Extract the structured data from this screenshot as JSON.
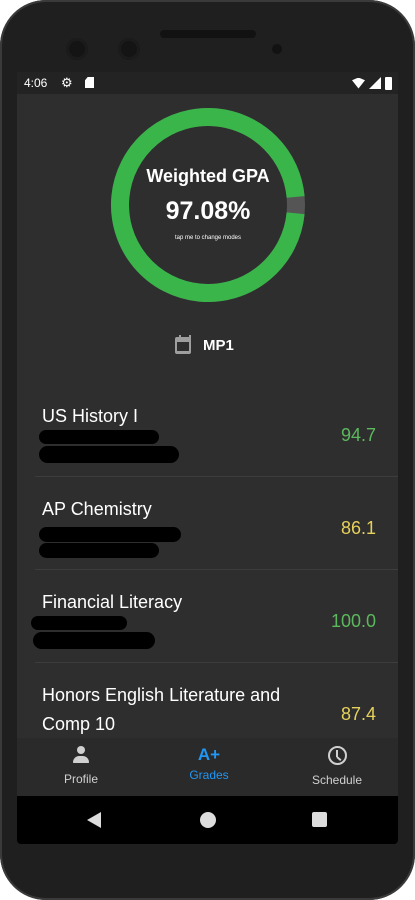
{
  "status_bar": {
    "time": "4:06",
    "icons": [
      "gear-icon",
      "sd-card-icon",
      "wifi-icon",
      "signal-icon",
      "battery-icon"
    ]
  },
  "gpa": {
    "title": "Weighted GPA",
    "value": "97.08%",
    "hint": "tap me to change modes",
    "ring_fraction": 0.97,
    "ring_color": "#3ab54a",
    "track_color": "#555555"
  },
  "period": {
    "label": "MP1",
    "icon": "calendar-icon"
  },
  "courses": [
    {
      "name": "US History I",
      "grade": "94.7",
      "grade_color": "#5cb85c"
    },
    {
      "name": "AP Chemistry",
      "grade": "86.1",
      "grade_color": "#e6d15a"
    },
    {
      "name": "Financial Literacy",
      "grade": "100.0",
      "grade_color": "#5cb85c"
    },
    {
      "name": "Honors English Literature and Comp 10",
      "grade": "87.4",
      "grade_color": "#e6d15a"
    }
  ],
  "bottom_nav": {
    "active": "grades",
    "active_color": "#2196f3",
    "items": [
      {
        "label": "Profile",
        "icon": "person-icon"
      },
      {
        "label": "Grades",
        "icon": "A+"
      },
      {
        "label": "Schedule",
        "icon": "clock-icon"
      }
    ]
  }
}
